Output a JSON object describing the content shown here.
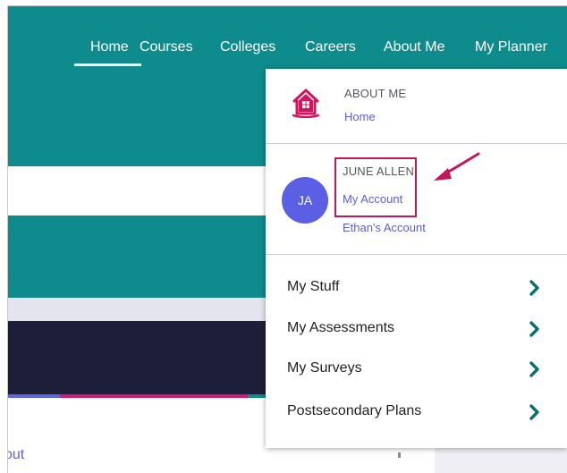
{
  "nav": {
    "items": [
      "Home",
      "Courses",
      "Colleges",
      "Careers",
      "About Me",
      "My Planner"
    ],
    "active": "Home"
  },
  "dropdown": {
    "about_section": {
      "label": "ABOUT ME",
      "link": "Home",
      "icon": "house-icon"
    },
    "account_section": {
      "avatar_initials": "JA",
      "user_name": "JUNE ALLEN",
      "my_account_link": "My Account",
      "other_account_link": "Ethan's Account"
    },
    "menu_items": [
      "My Stuff",
      "My Assessments",
      "My Surveys",
      "Postsecondary Plans"
    ]
  },
  "background": {
    "partial_text": "out"
  },
  "colors": {
    "teal": "#0e8b8c",
    "dark_navy": "#1d1e39",
    "link_purple": "#5b5fd1",
    "avatar_purple": "#5b5fe3",
    "highlight_magenta": "#c2185b",
    "house_magenta": "#d0145e",
    "chevron_teal": "#0a6e73"
  }
}
